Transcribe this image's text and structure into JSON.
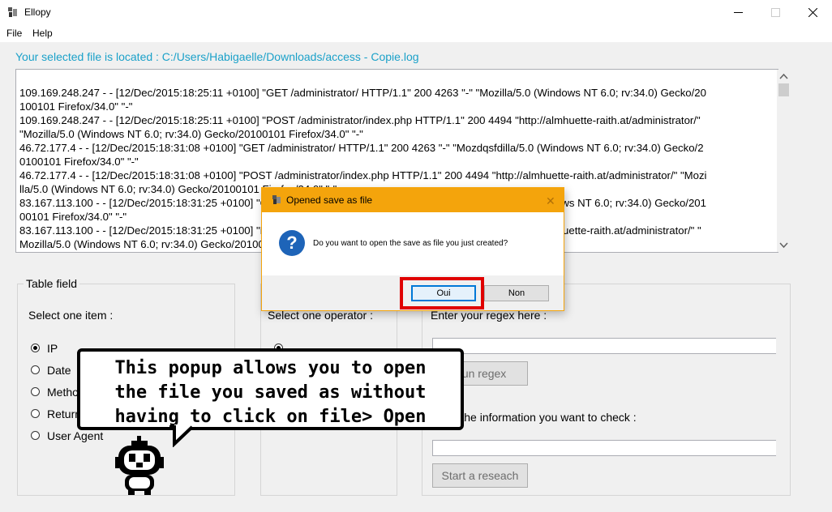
{
  "window": {
    "title": "Ellopy"
  },
  "menu": {
    "file": "File",
    "help": "Help"
  },
  "path_label": "Your selected file is located : C:/Users/Habigaelle/Downloads/access - Copie.log",
  "log_lines": [
    "109.169.248.247 - - [12/Dec/2015:18:25:11 +0100] \"GET /administrator/ HTTP/1.1\" 200 4263 \"-\" \"Mozilla/5.0 (Windows NT 6.0; rv:34.0) Gecko/20",
    "100101 Firefox/34.0\" \"-\"",
    "109.169.248.247 - - [12/Dec/2015:18:25:11 +0100] \"POST /administrator/index.php HTTP/1.1\" 200 4494 \"http://almhuette-raith.at/administrator/\"",
    "\"Mozilla/5.0 (Windows NT 6.0; rv:34.0) Gecko/20100101 Firefox/34.0\" \"-\"",
    "46.72.177.4 - - [12/Dec/2015:18:31:08 +0100] \"GET /administrator/ HTTP/1.1\" 200 4263 \"-\" \"Mozdqsfdilla/5.0 (Windows NT 6.0; rv:34.0) Gecko/2",
    "0100101 Firefox/34.0\" \"-\"",
    "46.72.177.4 - - [12/Dec/2015:18:31:08 +0100] \"POST /administrator/index.php HTTP/1.1\" 200 4494 \"http://almhuette-raith.at/administrator/\" \"Mozi",
    "lla/5.0 (Windows NT 6.0; rv:34.0) Gecko/20100101 Firefox/34.0\" \"-\"",
    "83.167.113.100 - - [12/Dec/2015:18:31:25 +0100] \"GET /administrator/ HTTP/1.1\" 200 4263 \"-\" \"Mozilla/5.0 (Windows NT 6.0; rv:34.0) Gecko/201",
    "00101 Firefox/34.0\" \"-\"",
    "83.167.113.100 - - [12/Dec/2015:18:31:25 +0100] \"POST /administrator/index.php HTTP/1.1\" 200 4494 \"http://almhuette-raith.at/administrator/\" \"",
    "Mozilla/5.0 (Windows NT 6.0; rv:34.0) Gecko/20100101 Firefox/34.0\" \"-\""
  ],
  "table_field": {
    "title": "Table field",
    "prompt": "Select one item :",
    "options": [
      "IP",
      "Date",
      "Method",
      "Return",
      "User Agent"
    ],
    "selected": "IP"
  },
  "operator": {
    "prompt": "Select one operator :"
  },
  "regex": {
    "prompt": "Enter your regex here :",
    "input_value": "",
    "run_button": "Run regex",
    "info_prompt": "Enter the information you want to check :",
    "info_value": "",
    "start_button": "Start a reseach"
  },
  "dialog": {
    "title": "Opened save as file",
    "message": "Do you want to open the save as file you just created?",
    "yes": "Oui",
    "no": "Non"
  },
  "bubble": {
    "lines": [
      "This popup allows you to open",
      "the file you saved as without",
      "having to click on file> Open"
    ]
  },
  "colors": {
    "path_label": "#1ba1c9",
    "dialog_accent": "#f4a40c",
    "highlight": "#e00000",
    "question_icon": "#1e64b8"
  },
  "icons": {
    "app": "app-icon",
    "dialog": "dialog-app-icon",
    "question": "question-icon",
    "mascot": "robot-mascot"
  }
}
